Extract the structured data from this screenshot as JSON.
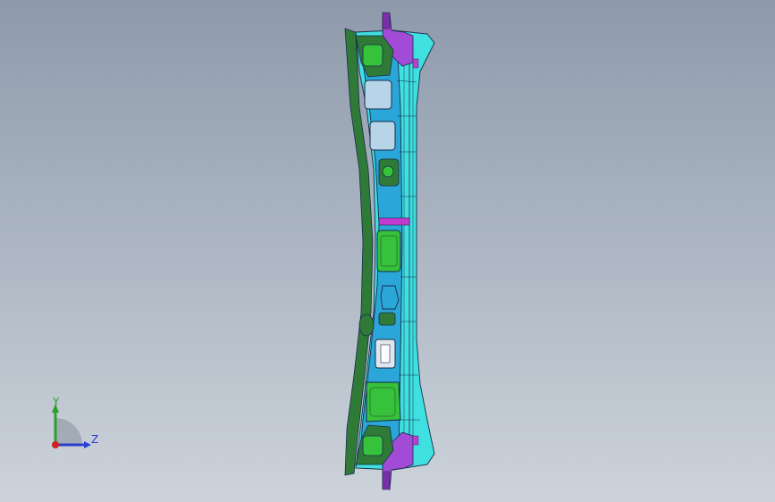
{
  "viewport": {
    "background_top": "#8e9aab",
    "background_bottom": "#cdd3da"
  },
  "model": {
    "description_colors": {
      "outer_flange": "#2f7a37",
      "main_beam": "#3fe0e0",
      "inner_panel": "#2aa7d8",
      "brackets": "#a14bd6",
      "pockets": "#36c23a",
      "edges": "#1a2a4a"
    }
  },
  "triad": {
    "y_label": "Y",
    "z_label": "Z",
    "y_color": "#2aa02a",
    "z_color": "#2a3fd0",
    "x_color": "#d02020"
  }
}
